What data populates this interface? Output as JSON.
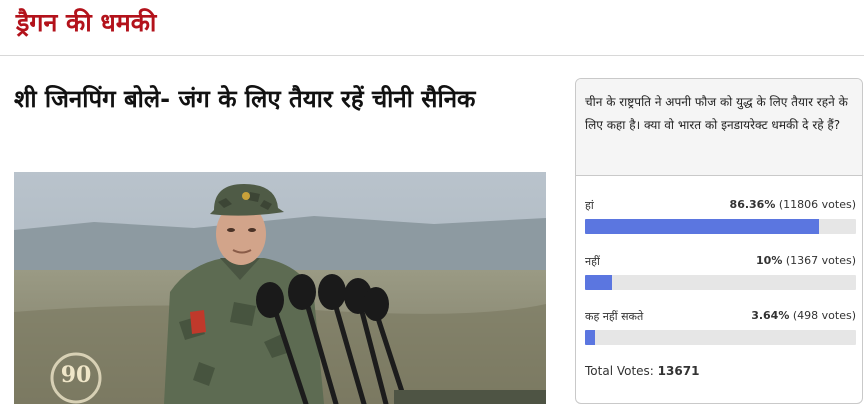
{
  "section": {
    "title": "ड्रैगन की धमकी"
  },
  "article": {
    "headline": "शी जिनपिंग बोले- जंग के लिए तैयार रहें चीनी सैनिक",
    "photo": {
      "watermark_badge": "90"
    }
  },
  "poll": {
    "question": "चीन के राष्ट्रपति ने अपनी फौज को युद्ध के लिए तैयार रहने के लिए कहा है। क्या वो भारत को इनडायरेक्ट धमकी दे रहे हैं?",
    "options": [
      {
        "label": "हां",
        "percent_text": "86.36%",
        "votes_text": "(11806 votes)",
        "fraction": 0.8636
      },
      {
        "label": "नहीं",
        "percent_text": "10%",
        "votes_text": "(1367 votes)",
        "fraction": 0.1
      },
      {
        "label": "कह नहीं सकते",
        "percent_text": "3.64%",
        "votes_text": "(498 votes)",
        "fraction": 0.0364
      }
    ],
    "total_label": "Total Votes:",
    "total_value": "13671",
    "bar_color": "#5b76e0"
  },
  "colors": {
    "section_title": "#b3121b"
  }
}
